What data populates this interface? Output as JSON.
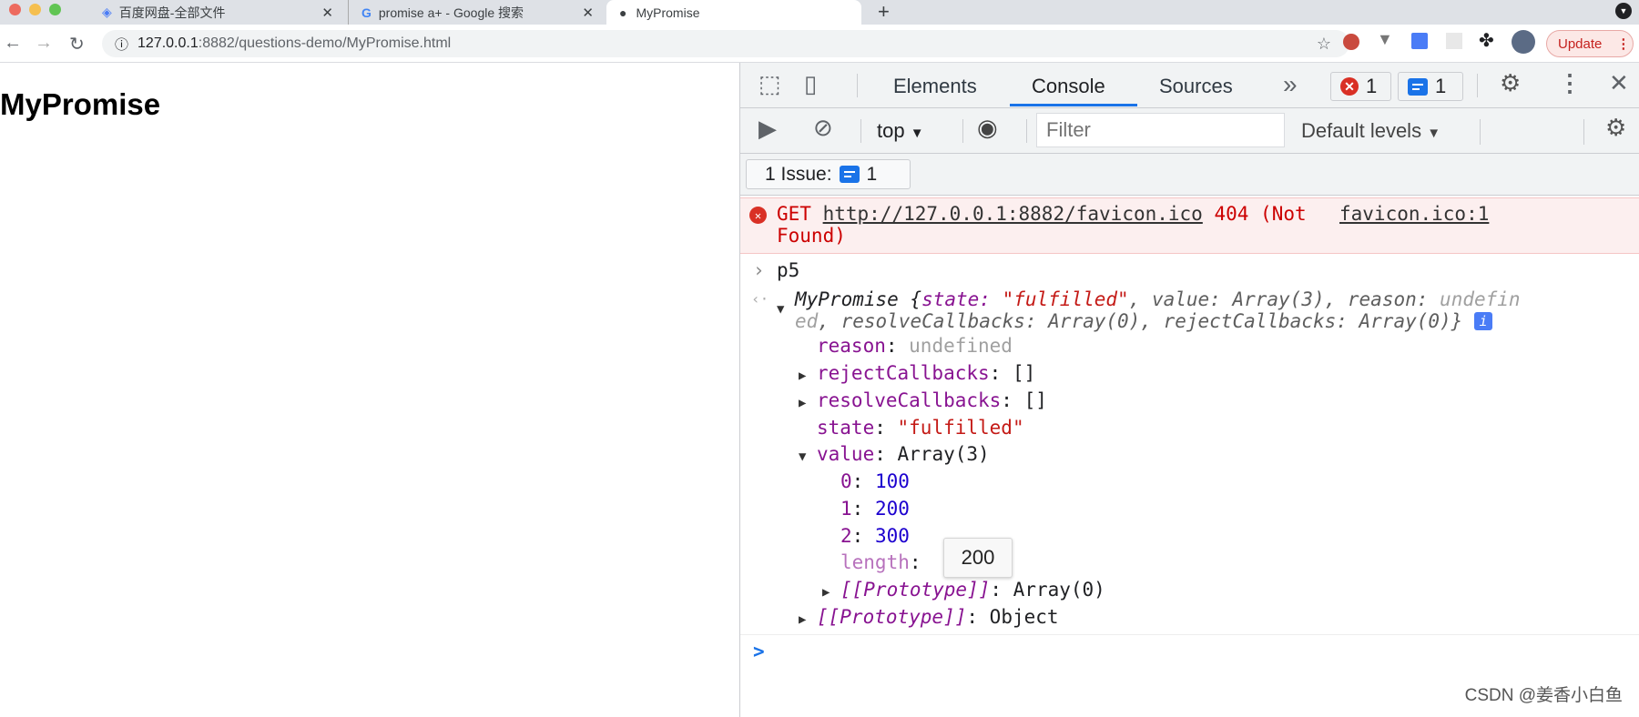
{
  "browser": {
    "tabs": [
      {
        "title": "百度网盘-全部文件",
        "icon": "baidu-netdisk-icon"
      },
      {
        "title": "promise a+ - Google 搜索",
        "icon": "google-icon"
      },
      {
        "title": "MyPromise",
        "icon": "globe-icon",
        "active": true
      }
    ],
    "new_tab": "+",
    "url_host": "127.0.0.1",
    "url_rest": ":8882/questions-demo/MyPromise.html",
    "update_label": "Update"
  },
  "page": {
    "heading": "MyPromise"
  },
  "devtools": {
    "tabs": [
      "Elements",
      "Console",
      "Sources"
    ],
    "active_tab": "Console",
    "more": "»",
    "error_count": "1",
    "issue_count": "1",
    "context": "top",
    "filter_placeholder": "Filter",
    "levels": "Default levels",
    "issues_label": "1 Issue:",
    "issues_num": "1"
  },
  "console": {
    "error": {
      "method": "GET",
      "url": "http://127.0.0.1:8882/favicon.ico",
      "status": "404 (Not",
      "status2": "Found)",
      "source": "favicon.ico:1"
    },
    "input": "p5",
    "summary1a": "MyPromise {",
    "summary1b": "state: ",
    "summary1c": "\"fulfilled\"",
    "summary1d": ", value: Array(3), reason: ",
    "summary1e": "undefin",
    "summary2a": "ed",
    "summary2b": ", resolveCallbacks: Array(0), rejectCallbacks: Array(0)}",
    "props": {
      "reason_k": "reason",
      "reason_v": "undefined",
      "reject_k": "rejectCallbacks",
      "reject_v": "[]",
      "resolve_k": "resolveCallbacks",
      "resolve_v": "[]",
      "state_k": "state",
      "state_v": "\"fulfilled\"",
      "value_k": "value",
      "value_v": "Array(3)",
      "items": [
        {
          "k": "0",
          "v": "100"
        },
        {
          "k": "1",
          "v": "200"
        },
        {
          "k": "2",
          "v": "300"
        }
      ],
      "length_k": "length",
      "proto_arr_k": "[[Prototype]]",
      "proto_arr_v": "Array(0)",
      "proto_obj_k": "[[Prototype]]",
      "proto_obj_v": "Object"
    },
    "tooltip": "200",
    "prompt": ">"
  },
  "watermark": "CSDN @姜香小白鱼",
  "colors": {
    "accent": "#1a73e8",
    "error": "#d93025",
    "error_bg": "#fcefef"
  }
}
